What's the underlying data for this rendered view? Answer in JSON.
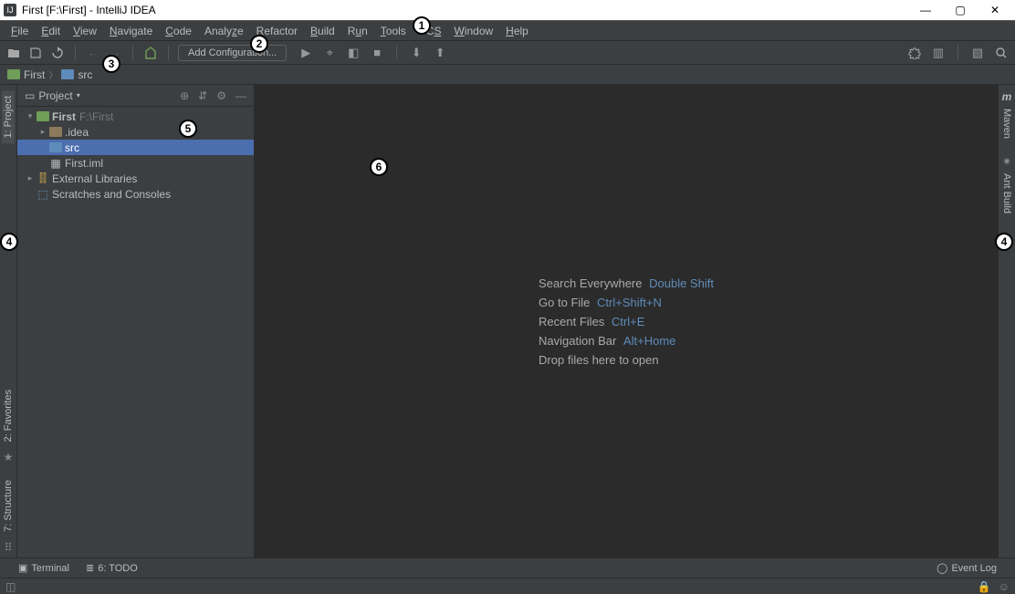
{
  "titlebar": {
    "app_icon_text": "IJ",
    "title": "First [F:\\First] - IntelliJ IDEA"
  },
  "menubar": {
    "items": [
      {
        "pre": "",
        "u": "F",
        "post": "ile"
      },
      {
        "pre": "",
        "u": "E",
        "post": "dit"
      },
      {
        "pre": "",
        "u": "V",
        "post": "iew"
      },
      {
        "pre": "",
        "u": "N",
        "post": "avigate"
      },
      {
        "pre": "",
        "u": "C",
        "post": "ode"
      },
      {
        "pre": "Analy",
        "u": "z",
        "post": "e"
      },
      {
        "pre": "",
        "u": "R",
        "post": "efactor"
      },
      {
        "pre": "",
        "u": "B",
        "post": "uild"
      },
      {
        "pre": "R",
        "u": "u",
        "post": "n"
      },
      {
        "pre": "",
        "u": "T",
        "post": "ools"
      },
      {
        "pre": "VC",
        "u": "S",
        "post": ""
      },
      {
        "pre": "",
        "u": "W",
        "post": "indow"
      },
      {
        "pre": "",
        "u": "H",
        "post": "elp"
      }
    ]
  },
  "toolbar": {
    "add_config_label": "Add Configuration..."
  },
  "breadcrumb": {
    "root": "First",
    "item2": "src"
  },
  "left_gutter": {
    "project": "1: Project",
    "favorites": "2: Favorites",
    "structure": "7: Structure"
  },
  "right_gutter": {
    "maven": "Maven",
    "ant": "Ant Build"
  },
  "project_panel": {
    "title": "Project",
    "tree": {
      "root_name": "First",
      "root_path": "F:\\First",
      "idea_dir": ".idea",
      "src_dir": "src",
      "iml_file": "First.iml",
      "ext_libs": "External Libraries",
      "scratches": "Scratches and Consoles"
    }
  },
  "editor": {
    "hints": [
      {
        "label": "Search Everywhere",
        "shortcut": "Double Shift"
      },
      {
        "label": "Go to File",
        "shortcut": "Ctrl+Shift+N"
      },
      {
        "label": "Recent Files",
        "shortcut": "Ctrl+E"
      },
      {
        "label": "Navigation Bar",
        "shortcut": "Alt+Home"
      },
      {
        "label": "Drop files here to open",
        "shortcut": ""
      }
    ]
  },
  "bottom_bar": {
    "terminal": "Terminal",
    "todo": "6: TODO",
    "event_log": "Event Log"
  },
  "annotations": {
    "a1": "1",
    "a2": "2",
    "a3": "3",
    "a4": "4",
    "a5": "5",
    "a6": "6"
  }
}
